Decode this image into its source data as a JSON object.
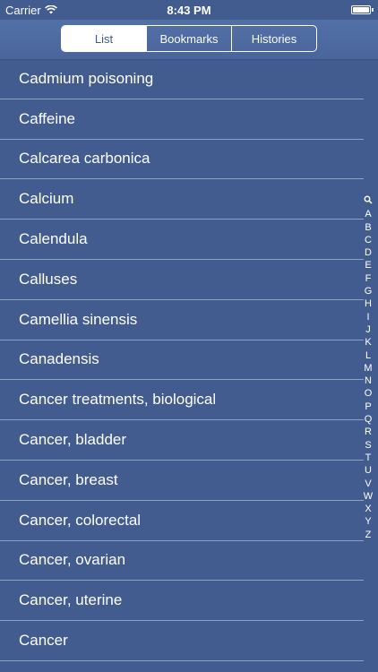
{
  "status_bar": {
    "carrier": "Carrier",
    "time": "8:43 PM"
  },
  "segments": [
    {
      "label": "List",
      "selected": true
    },
    {
      "label": "Bookmarks",
      "selected": false
    },
    {
      "label": "Histories",
      "selected": false
    }
  ],
  "list_items": [
    "Cadmium poisoning",
    "Caffeine",
    "Calcarea carbonica",
    "Calcium",
    "Calendula",
    "Calluses",
    "Camellia sinensis",
    "Canadensis",
    "Cancer treatments, biological",
    "Cancer, bladder",
    "Cancer, breast",
    "Cancer, colorectal",
    "Cancer, ovarian",
    "Cancer, uterine",
    "Cancer"
  ],
  "index_letters": [
    "A",
    "B",
    "C",
    "D",
    "E",
    "F",
    "G",
    "H",
    "I",
    "J",
    "K",
    "L",
    "M",
    "N",
    "O",
    "P",
    "Q",
    "R",
    "S",
    "T",
    "U",
    "V",
    "W",
    "X",
    "Y",
    "Z"
  ],
  "colors": {
    "background": "#425c8f",
    "nav_bar": "#4f6aa1",
    "separator": "#8fa2c6",
    "text": "#ffffff"
  }
}
